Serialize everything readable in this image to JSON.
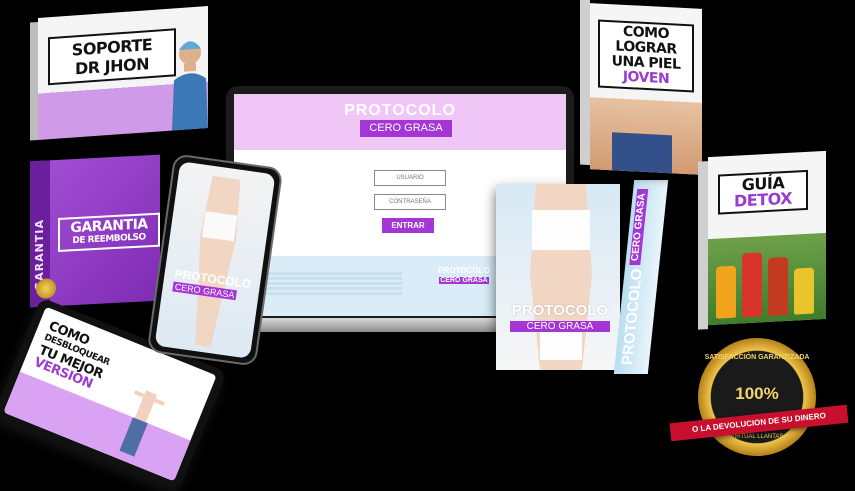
{
  "support_box": {
    "line1": "SOPORTE",
    "line2": "DR JHON"
  },
  "guarantee_box": {
    "side": "GARANTIA",
    "line1": "GARANTIA",
    "line2": "DE REEMBOLSO"
  },
  "tablet": {
    "line1": "COMO",
    "line2": "DESBLOQUEAR",
    "line3": "TU MEJOR",
    "line4": "VERSION"
  },
  "laptop": {
    "title": "PROTOCOLO",
    "subtitle": "CERO GRASA",
    "username_placeholder": "USUARIO",
    "password_placeholder": "CONTRASEÑA",
    "enter_button": "ENTRAR",
    "footer_logo_title": "PROTOCOLO",
    "footer_logo_sub": "CERO GRASA"
  },
  "phone": {
    "title": "PROTOCOLO",
    "subtitle": "CERO GRASA"
  },
  "book": {
    "title": "PROTOCOLO",
    "subtitle": "CERO GRASA"
  },
  "book_spine": {
    "title": "PROTOCOLO",
    "subtitle": "CERO GRASA"
  },
  "piel_box": {
    "line1": "COMO",
    "line2": "LOGRAR",
    "line3": "UNA PIEL",
    "line4": "JOVEN"
  },
  "detox_box": {
    "line1": "GUÍA",
    "line2": "DETOX"
  },
  "seal": {
    "top": "SATISFACCIÓN GARANTIZADA",
    "percent": "100%",
    "ribbon": "O LA DEVOLUCION DE SU DINERO",
    "bottom": "VIRTUAL LLANTAS"
  },
  "colors": {
    "accent": "#a436d6",
    "pink": "#f0c6f7",
    "background": "#000000"
  }
}
